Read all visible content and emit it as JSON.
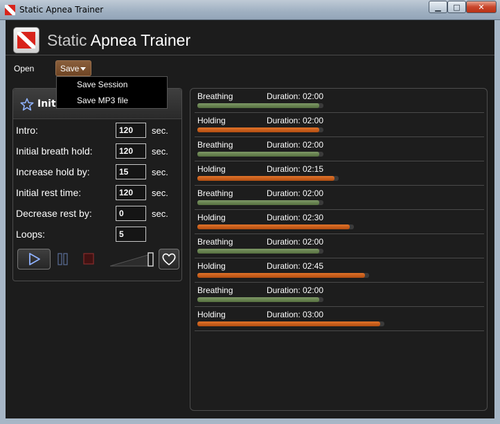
{
  "window": {
    "title": "Static Apnea Trainer",
    "controls": {
      "minimize": "▁",
      "maximize": "□",
      "close": "✕"
    }
  },
  "header": {
    "title_light": "Static",
    "title_bold": "Apnea Trainer"
  },
  "menu": {
    "open_label": "Open",
    "save_label": "Save",
    "save_dropdown": [
      "Save Session",
      "Save MP3 file"
    ]
  },
  "settings_panel": {
    "title": "Initi",
    "fields": [
      {
        "label": "Intro:",
        "value": "120",
        "unit": "sec."
      },
      {
        "label": "Initial breath hold:",
        "value": "120",
        "unit": "sec."
      },
      {
        "label": "Increase hold by:",
        "value": "15",
        "unit": "sec."
      },
      {
        "label": "Initial rest time:",
        "value": "120",
        "unit": "sec."
      },
      {
        "label": "Decrease rest by:",
        "value": "0",
        "unit": "sec."
      },
      {
        "label": "Loops:",
        "value": "5",
        "unit": ""
      }
    ],
    "controls": [
      "play-icon",
      "pause-icon",
      "stop-icon",
      "volume-icon",
      "heart-icon"
    ]
  },
  "session": {
    "duration_label": "Duration:",
    "max_duration_seconds": 180,
    "colors": {
      "breathing": "#6d8a55",
      "holding": "#d0621d"
    },
    "phases": [
      {
        "name": "Breathing",
        "duration": "02:00",
        "seconds": 120,
        "kind": "breath"
      },
      {
        "name": "Holding",
        "duration": "02:00",
        "seconds": 120,
        "kind": "hold"
      },
      {
        "name": "Breathing",
        "duration": "02:00",
        "seconds": 120,
        "kind": "breath"
      },
      {
        "name": "Holding",
        "duration": "02:15",
        "seconds": 135,
        "kind": "hold"
      },
      {
        "name": "Breathing",
        "duration": "02:00",
        "seconds": 120,
        "kind": "breath"
      },
      {
        "name": "Holding",
        "duration": "02:30",
        "seconds": 150,
        "kind": "hold"
      },
      {
        "name": "Breathing",
        "duration": "02:00",
        "seconds": 120,
        "kind": "breath"
      },
      {
        "name": "Holding",
        "duration": "02:45",
        "seconds": 165,
        "kind": "hold"
      },
      {
        "name": "Breathing",
        "duration": "02:00",
        "seconds": 120,
        "kind": "breath"
      },
      {
        "name": "Holding",
        "duration": "03:00",
        "seconds": 180,
        "kind": "hold"
      }
    ]
  }
}
